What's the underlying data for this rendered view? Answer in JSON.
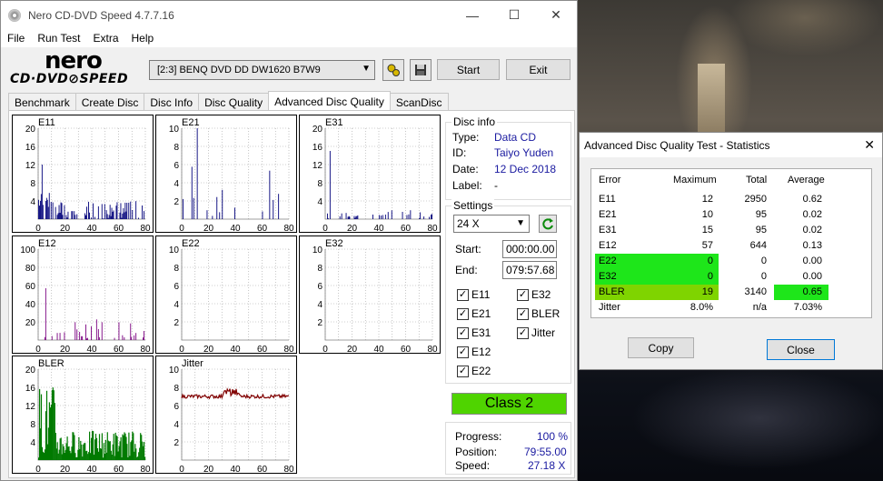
{
  "window": {
    "title": "Nero CD-DVD Speed 4.7.7.16",
    "min_glyph": "—",
    "max_glyph": "☐",
    "close_glyph": "✕"
  },
  "menu": [
    "File",
    "Run Test",
    "Extra",
    "Help"
  ],
  "logo": {
    "nero": "nero",
    "cdspeed": "CD·DVD⊘SPEED"
  },
  "toolbar": {
    "drive": "[2:3]   BENQ DVD DD DW1620 B7W9",
    "start_label": "Start",
    "exit_label": "Exit"
  },
  "tabs": [
    "Benchmark",
    "Create Disc",
    "Disc Info",
    "Disc Quality",
    "Advanced Disc Quality",
    "ScanDisc"
  ],
  "active_tab": "Advanced Disc Quality",
  "graphs": [
    {
      "name": "E11",
      "ymax": 20,
      "yticks": [
        "20",
        "16",
        "12",
        "8",
        "4"
      ],
      "xticks": [
        "0",
        "20",
        "40",
        "60",
        "80"
      ],
      "color": "#00007a"
    },
    {
      "name": "E21",
      "ymax": 10,
      "yticks": [
        "10",
        "8",
        "6",
        "4",
        "2"
      ],
      "xticks": [
        "0",
        "20",
        "40",
        "60",
        "80"
      ],
      "color": "#00007a"
    },
    {
      "name": "E31",
      "ymax": 20,
      "yticks": [
        "20",
        "16",
        "12",
        "8",
        "4"
      ],
      "xticks": [
        "0",
        "20",
        "40",
        "60",
        "80"
      ],
      "color": "#00007a"
    },
    {
      "name": "E12",
      "ymax": 100,
      "yticks": [
        "100",
        "80",
        "60",
        "40",
        "20"
      ],
      "xticks": [
        "0",
        "20",
        "40",
        "60",
        "80"
      ],
      "color": "#7a0080"
    },
    {
      "name": "E22",
      "ymax": 10,
      "yticks": [
        "10",
        "8",
        "6",
        "4",
        "2"
      ],
      "xticks": [
        "0",
        "20",
        "40",
        "60",
        "80"
      ],
      "color": "#7a0080"
    },
    {
      "name": "E32",
      "ymax": 10,
      "yticks": [
        "10",
        "8",
        "6",
        "4",
        "2"
      ],
      "xticks": [
        "0",
        "20",
        "40",
        "60",
        "80"
      ],
      "color": "#7a0080"
    },
    {
      "name": "BLER",
      "ymax": 20,
      "yticks": [
        "20",
        "16",
        "12",
        "8",
        "4"
      ],
      "xticks": [
        "0",
        "20",
        "40",
        "60",
        "80"
      ],
      "color": "#007a00"
    },
    {
      "name": "Jitter",
      "ymax": 10,
      "yticks": [
        "10",
        "8",
        "6",
        "4",
        "2"
      ],
      "xticks": [
        "0",
        "20",
        "40",
        "60",
        "80"
      ],
      "color": "#800000"
    }
  ],
  "disc_info": {
    "title": "Disc info",
    "type_label": "Type:",
    "type": "Data CD",
    "id_label": "ID:",
    "id": "Taiyo Yuden",
    "date_label": "Date:",
    "date": "12 Dec 2018",
    "label_label": "Label:",
    "label": "-"
  },
  "settings": {
    "title": "Settings",
    "speed": "24 X",
    "start_label": "Start:",
    "start": "000:00.00",
    "end_label": "End:",
    "end": "079:57.68",
    "checks": [
      {
        "label": "E11",
        "checked": true
      },
      {
        "label": "E32",
        "checked": true
      },
      {
        "label": "E21",
        "checked": true
      },
      {
        "label": "BLER",
        "checked": true
      },
      {
        "label": "E31",
        "checked": true
      },
      {
        "label": "Jitter",
        "checked": true
      },
      {
        "label": "E12",
        "checked": true
      },
      {
        "label": "E22",
        "checked": true
      }
    ]
  },
  "class": "Class 2",
  "progress": {
    "progress_label": "Progress:",
    "progress": "100 %",
    "position_label": "Position:",
    "position": "79:55.00",
    "speed_label": "Speed:",
    "speed": "27.18 X"
  },
  "stats_dialog": {
    "title": "Advanced Disc Quality Test - Statistics",
    "headers": [
      "Error",
      "Maximum",
      "Total",
      "Average"
    ],
    "rows": [
      {
        "error": "E11",
        "max": "12",
        "total": "2950",
        "avg": "0.62"
      },
      {
        "error": "E21",
        "max": "10",
        "total": "95",
        "avg": "0.02"
      },
      {
        "error": "E31",
        "max": "15",
        "total": "95",
        "avg": "0.02"
      },
      {
        "error": "E12",
        "max": "57",
        "total": "644",
        "avg": "0.13"
      },
      {
        "error": "E22",
        "max": "0",
        "total": "0",
        "avg": "0.00"
      },
      {
        "error": "E32",
        "max": "0",
        "total": "0",
        "avg": "0.00"
      },
      {
        "error": "BLER",
        "max": "19",
        "total": "3140",
        "avg": "0.65"
      },
      {
        "error": "Jitter",
        "max": "8.0%",
        "total": "n/a",
        "avg": "7.03%"
      }
    ],
    "copy_label": "Copy",
    "close_label": "Close"
  },
  "colors": {
    "class_green": "#4fd400",
    "highlight_green": "#1ee61a",
    "highlight_lime": "#7fd400"
  }
}
